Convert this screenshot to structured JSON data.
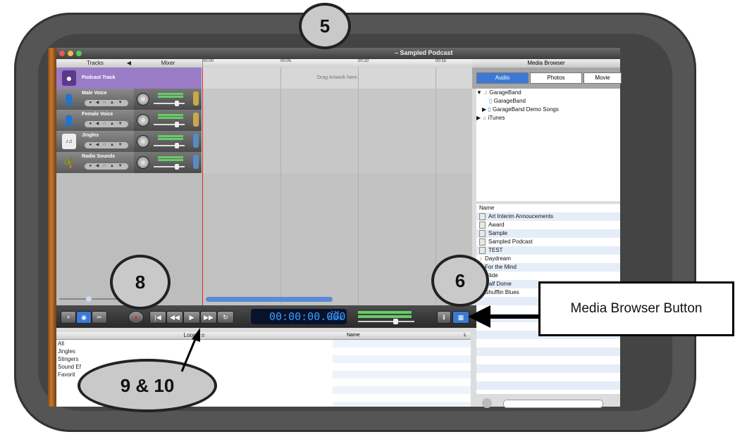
{
  "app": {
    "window_title": "– Sampled Podcast",
    "colors": {
      "frame": "#555555",
      "lcd_text": "#3a9cff",
      "podcast_track": "#9a7cc6",
      "playhead": "#dd2222"
    }
  },
  "header": {
    "tracks_label": "Tracks",
    "mixer_label": "Mixer",
    "media_browser_label": "Media Browser",
    "ruler_ticks": [
      "00:00",
      "00:05",
      "00:10",
      "00:15"
    ]
  },
  "tracks": [
    {
      "name": "Podcast Track",
      "icon": "podcast-icon",
      "lane_text": "Drag Artwork here."
    },
    {
      "name": "Male Voice",
      "icon": "male-voice-icon"
    },
    {
      "name": "Female Voice",
      "icon": "female-voice-icon"
    },
    {
      "name": "Jingles",
      "icon": "jingles-icon"
    },
    {
      "name": "Radio Sounds",
      "icon": "radio-sounds-icon"
    }
  ],
  "transport": {
    "time": "00:00:00.000",
    "tempo_value": "120",
    "tempo_label": "TEMPO"
  },
  "loops": {
    "header": "Loops ≑",
    "items": [
      "All",
      "Jingles",
      "Stingers",
      "Sound Ef",
      "Favorit"
    ],
    "name_column": "Name",
    "l_column": "L"
  },
  "media_browser": {
    "tabs": [
      "Audio",
      "Photos",
      "Movie"
    ],
    "tree": [
      "GarageBand",
      "GarageBand",
      "GarageBand Demo Songs",
      "iTunes"
    ],
    "name_column": "Name",
    "files": [
      "Art Interim Annoucements",
      "Award",
      "Sample",
      "Sampled Podcast",
      "TEST",
      "Daydream",
      "For the Mind",
      "Glide",
      "Half Dome",
      "Shufflin Blues"
    ]
  },
  "annotations": {
    "bubble_top": "5",
    "bubble_left": "8",
    "bubble_right": "6",
    "bubble_bottom": "9 & 10",
    "callout": "Media Browser Button"
  }
}
